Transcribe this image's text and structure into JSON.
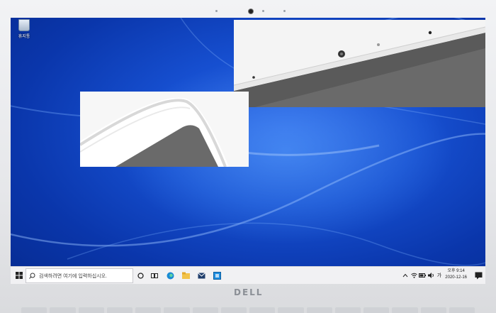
{
  "desktop": {
    "recycle_bin_label": "휴지통"
  },
  "taskbar": {
    "search_placeholder": "검색하려면 여기에 입력하십시오.",
    "ime_indicator": "가",
    "time": "오후 9:14",
    "date": "2020-12-16"
  },
  "logo": {
    "text": "DELL"
  },
  "colors": {
    "wallpaper": "#164fd0",
    "taskbar": "#f1f1f3",
    "bezel": "#e9eaec"
  }
}
